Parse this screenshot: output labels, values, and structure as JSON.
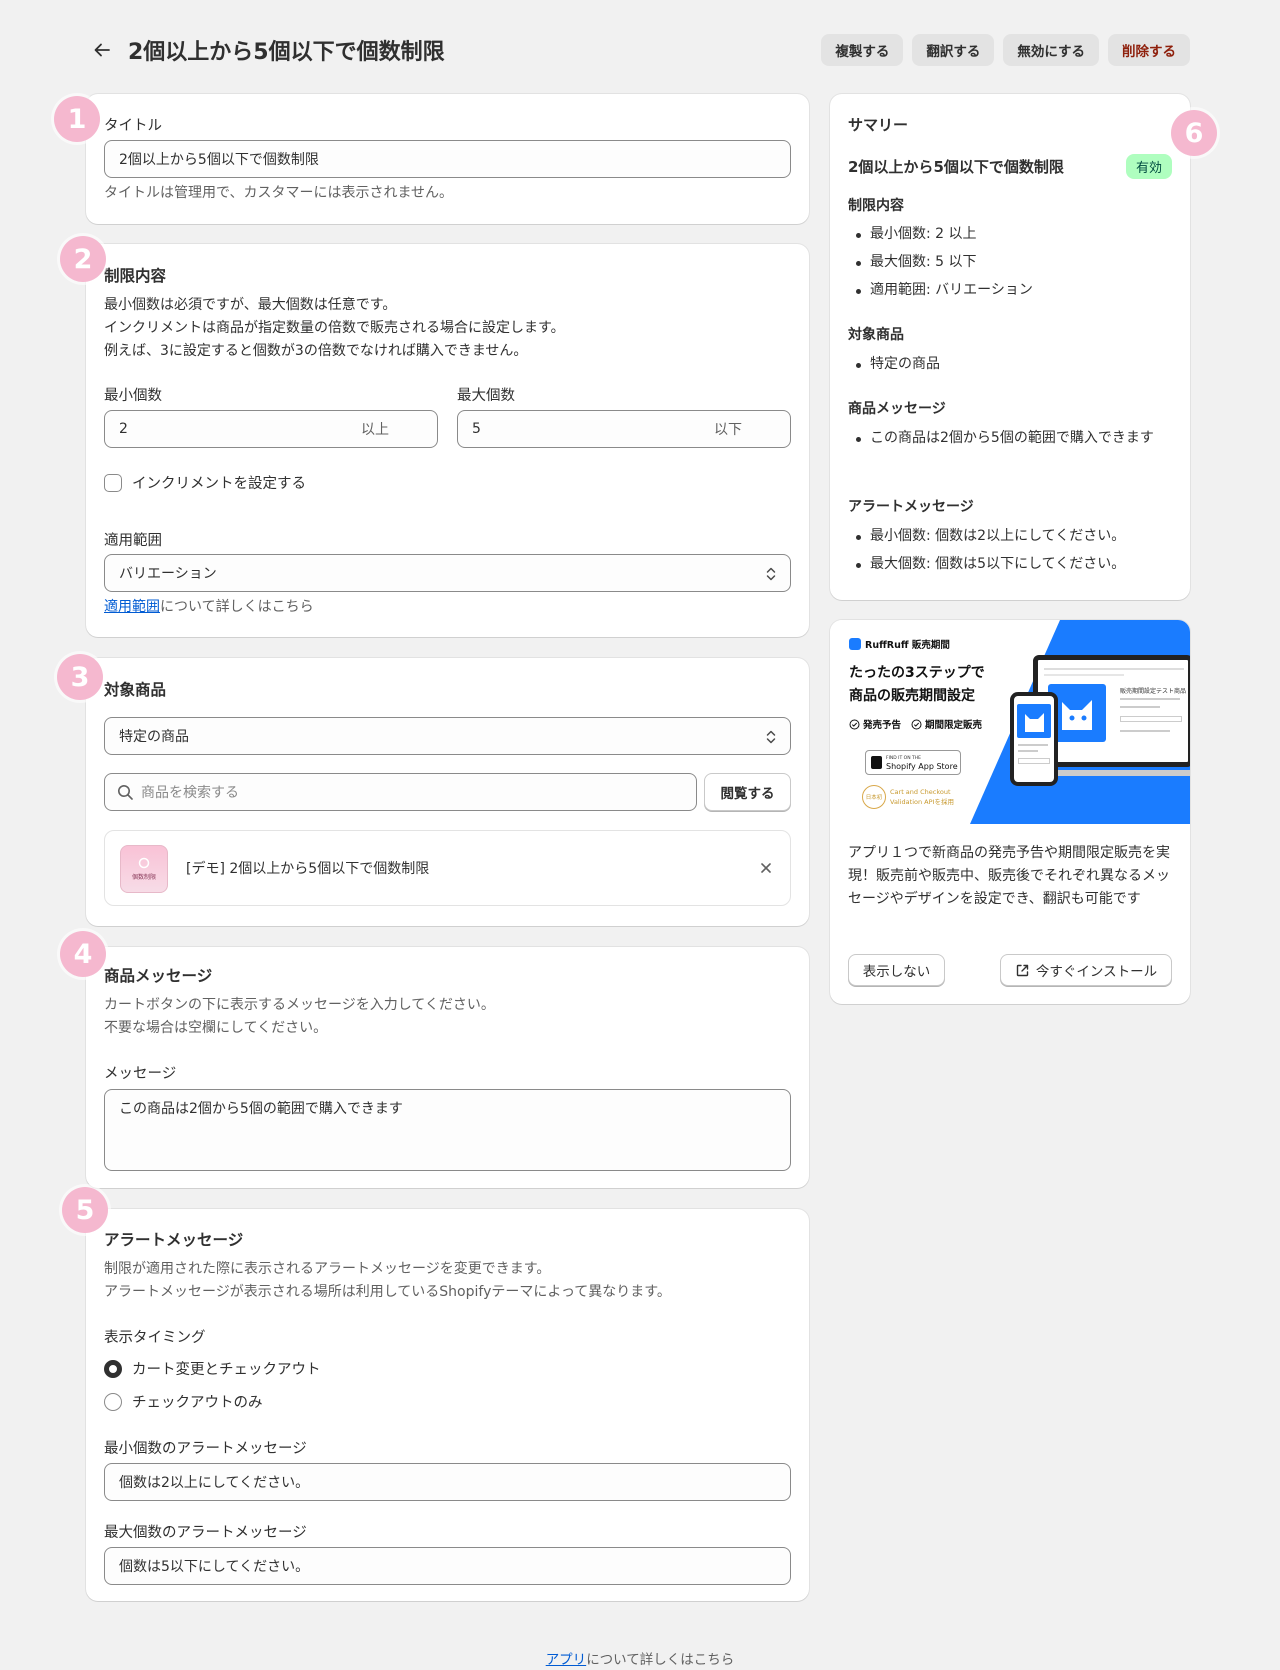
{
  "header": {
    "title": "2個以上から5個以下で個数制限",
    "actions": {
      "duplicate": "複製する",
      "translate": "翻訳する",
      "disable": "無効にする",
      "delete": "削除する"
    }
  },
  "badges": [
    "1",
    "2",
    "3",
    "4",
    "5",
    "6"
  ],
  "title_section": {
    "label": "タイトル",
    "value": "2個以上から5個以下で個数制限",
    "help": "タイトルは管理用で、カスタマーには表示されません。"
  },
  "limit_section": {
    "heading": "制限内容",
    "desc1": "最小個数は必須ですが、最大個数は任意です。",
    "desc2": "インクリメントは商品が指定数量の倍数で販売される場合に設定します。",
    "desc3": "例えば、3に設定すると個数が3の倍数でなければ購入できません。",
    "min_label": "最小個数",
    "min_value": "2",
    "min_suffix": "以上",
    "max_label": "最大個数",
    "max_value": "5",
    "max_suffix": "以下",
    "increment_label": "インクリメントを設定する",
    "scope_label": "適用範囲",
    "scope_value": "バリエーション",
    "scope_link": "適用範囲",
    "scope_link_rest": "について詳しくはこちら"
  },
  "products_section": {
    "heading": "対象商品",
    "select_value": "特定の商品",
    "search_placeholder": "商品を検索する",
    "browse": "閲覧する",
    "thumb_text": "個数制限",
    "item": "[デモ] 2個以上から5個以下で個数制限"
  },
  "message_section": {
    "heading": "商品メッセージ",
    "desc1": "カートボタンの下に表示するメッセージを入力してください。",
    "desc2": "不要な場合は空欄にしてください。",
    "label": "メッセージ",
    "value": "この商品は2個から5個の範囲で購入できます"
  },
  "alert_section": {
    "heading": "アラートメッセージ",
    "desc1": "制限が適用された際に表示されるアラートメッセージを変更できます。",
    "desc2": "アラートメッセージが表示される場所は利用しているShopifyテーマによって異なります。",
    "timing_label": "表示タイミング",
    "opt1": "カート変更とチェックアウト",
    "opt2": "チェックアウトのみ",
    "min_label": "最小個数のアラートメッセージ",
    "min_value": "個数は2以上にしてください。",
    "max_label": "最大個数のアラートメッセージ",
    "max_value": "個数は5以下にしてください。"
  },
  "summary": {
    "heading": "サマリー",
    "name": "2個以上から5個以下で個数制限",
    "status": "有効",
    "limit_heading": "制限内容",
    "limit_items": [
      "最小個数: 2 以上",
      "最大個数: 5 以下",
      "適用範囲: バリエーション"
    ],
    "products_heading": "対象商品",
    "products_items": [
      "特定の商品"
    ],
    "message_heading": "商品メッセージ",
    "message_items": [
      "この商品は2個から5個の範囲で購入できます"
    ],
    "alert_heading": "アラートメッセージ",
    "alert_items": [
      "最小個数: 個数は2以上にしてください。",
      "最大個数: 個数は5以下にしてください。"
    ]
  },
  "promo": {
    "brand": "RuffRuff 販売期間",
    "headline1": "たったの3ステップで",
    "headline2": "商品の販売期間設定",
    "check1": "発売予告",
    "check2": "期間限定販売",
    "store_small": "FIND IT ON THE",
    "store": "Shopify App Store",
    "award_badge": "日本初",
    "award1": "Cart and Checkout",
    "award2": "Validation APIを採用",
    "screen_title": "販売期間設定テスト商品",
    "desc": "アプリ１つで新商品の発売予告や期間限定販売を実現！販売前や販売中、販売後でそれぞれ異なるメッセージやデザインを設定でき、翻訳も可能です",
    "dismiss": "表示しない",
    "install": "今すぐインストール"
  },
  "footer": {
    "link": "アプリ",
    "rest": "について詳しくはこちら"
  },
  "colors": {
    "badge": "#f5b8cf",
    "link": "#005bd3",
    "danger": "#8e1f0b",
    "promo_blue": "#1a7cff",
    "status_bg": "#affebf"
  }
}
